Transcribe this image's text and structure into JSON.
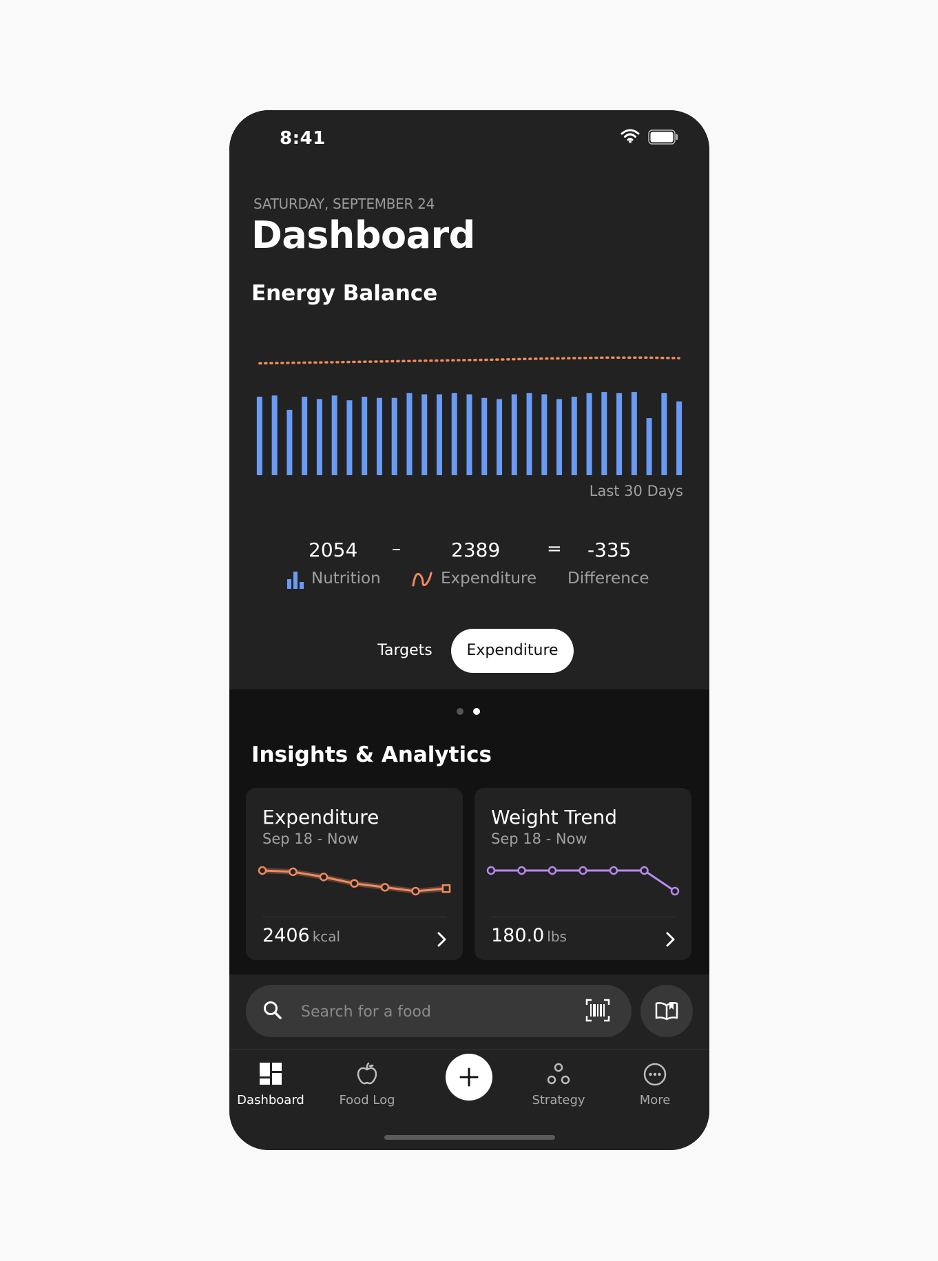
{
  "status_bar": {
    "time": "8:41"
  },
  "header": {
    "date": "SATURDAY, SEPTEMBER 24",
    "title": "Dashboard"
  },
  "energy_balance": {
    "title": "Energy Balance",
    "range_label": "Last 30 Days",
    "nutrition_value": "2054",
    "nutrition_label": "Nutrition",
    "minus": "–",
    "expenditure_value": "2389",
    "expenditure_label": "Expenditure",
    "equals": "=",
    "difference_value": "-335",
    "difference_label": "Difference",
    "toggle": {
      "options": [
        "Targets",
        "Expenditure"
      ],
      "selected": "Expenditure"
    },
    "page_dots": {
      "count": 2,
      "active": 1
    }
  },
  "chart_data": {
    "type": "bar",
    "series": [
      {
        "name": "Nutrition",
        "color": "#6a9bf4",
        "values": [
          2060,
          2070,
          1950,
          2060,
          2040,
          2070,
          2030,
          2060,
          2050,
          2050,
          2090,
          2080,
          2080,
          2090,
          2080,
          2050,
          2040,
          2080,
          2090,
          2080,
          2040,
          2060,
          2090,
          2100,
          2090,
          2100,
          1880,
          2090,
          2020
        ]
      },
      {
        "name": "Expenditure",
        "color": "#f28a5c",
        "style": "dotted-line",
        "values": [
          2340,
          2342,
          2344,
          2346,
          2348,
          2350,
          2352,
          2354,
          2356,
          2358,
          2360,
          2362,
          2364,
          2366,
          2368,
          2370,
          2372,
          2375,
          2378,
          2380,
          2382,
          2384,
          2386,
          2388,
          2389,
          2389,
          2388,
          2386,
          2384
        ]
      }
    ],
    "xlabel": "Last 30 Days",
    "ylim": [
      0,
      2500
    ]
  },
  "insights": {
    "title": "Insights & Analytics",
    "cards": [
      {
        "title": "Expenditure",
        "subtitle": "Sep 18 - Now",
        "value": "2406",
        "unit": "kcal",
        "color": "#f28a5c",
        "trend": [
          2420,
          2419,
          2415,
          2410,
          2407,
          2404,
          2406
        ]
      },
      {
        "title": "Weight Trend",
        "subtitle": "Sep 18 - Now",
        "value": "180.0",
        "unit": "lbs",
        "color": "#b98bf0",
        "trend": [
          180.6,
          180.6,
          180.6,
          180.6,
          180.6,
          180.6,
          180.0
        ]
      }
    ]
  },
  "search": {
    "placeholder": "Search for a food"
  },
  "tab_bar": {
    "items": [
      {
        "label": "Dashboard",
        "icon": "dashboard-icon",
        "active": true
      },
      {
        "label": "Food Log",
        "icon": "apple-icon",
        "active": false
      },
      {
        "label": "Strategy",
        "icon": "strategy-icon",
        "active": false
      },
      {
        "label": "More",
        "icon": "more-icon",
        "active": false
      }
    ]
  },
  "colors": {
    "accent_blue": "#6a9bf4",
    "accent_orange": "#f28a5c",
    "accent_purple": "#b98bf0",
    "panel": "#222222",
    "background": "#121212"
  }
}
